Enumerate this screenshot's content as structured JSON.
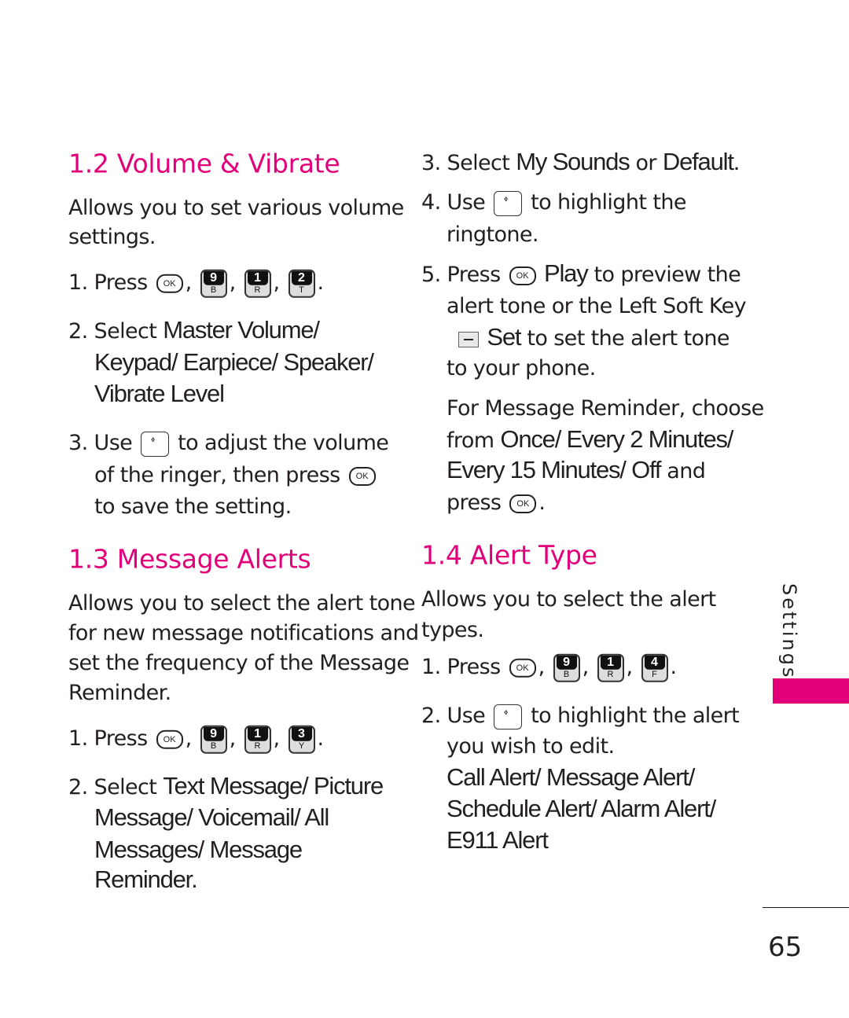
{
  "colors": {
    "accent": "#e2007a",
    "text": "#231f20"
  },
  "lines": [
    [
      {
        "h": "1.2 Volume & Vibrate"
      }
    ],
    [
      {
        "t": "Allows you to set various volume"
      }
    ],
    [
      {
        "t": "settings."
      }
    ],
    [
      {
        "t": "1. Press "
      },
      {
        "key": "ok",
        "d": "OK"
      },
      {
        "t": ", "
      },
      {
        "key": "num",
        "d": "9",
        "s": "B"
      },
      {
        "t": ", "
      },
      {
        "key": "num",
        "d": "1",
        "s": "R"
      },
      {
        "t": ", "
      },
      {
        "key": "num",
        "d": "2",
        "s": "T"
      },
      {
        "t": "."
      }
    ],
    [
      {
        "t": "2. Select "
      },
      {
        "b": "Master Volume/"
      }
    ],
    [
      {
        "b": "Keypad/ Earpiece/ Speaker/"
      }
    ],
    [
      {
        "b": "Vibrate Level"
      }
    ],
    [
      {
        "t": "3. Use "
      },
      {
        "key": "nav"
      },
      {
        "t": " to adjust the volume"
      }
    ],
    [
      {
        "t": "of the ringer, then press "
      },
      {
        "key": "ok",
        "d": "OK"
      }
    ],
    [
      {
        "t": "to save the setting."
      }
    ],
    [
      {
        "h": "1.3 Message Alerts"
      }
    ],
    [
      {
        "t": "Allows you to select the alert tone"
      }
    ],
    [
      {
        "t": "for new message notifications and"
      }
    ],
    [
      {
        "t": "set the frequency of the Message"
      }
    ],
    [
      {
        "t": "Reminder."
      }
    ],
    [
      {
        "t": "1. Press "
      },
      {
        "key": "ok",
        "d": "OK"
      },
      {
        "t": ", "
      },
      {
        "key": "num",
        "d": "9",
        "s": "B"
      },
      {
        "t": ", "
      },
      {
        "key": "num",
        "d": "1",
        "s": "R"
      },
      {
        "t": ", "
      },
      {
        "key": "num",
        "d": "3",
        "s": "Y"
      },
      {
        "t": "."
      }
    ],
    [
      {
        "t": "2. Select "
      },
      {
        "b": "Text Message/ Picture"
      }
    ],
    [
      {
        "b": "Message/ Voicemail/ All"
      }
    ],
    [
      {
        "b": "Messages/ Message"
      }
    ],
    [
      {
        "b": "Reminder."
      }
    ],
    [
      {
        "t": "3. Select "
      },
      {
        "b": "My Sounds"
      },
      {
        "t": " or "
      },
      {
        "b": "Default."
      }
    ],
    [
      {
        "t": "4. Use "
      },
      {
        "key": "nav"
      },
      {
        "t": " to highlight the"
      }
    ],
    [
      {
        "t": "ringtone."
      }
    ],
    [
      {
        "t": "5. Press "
      },
      {
        "key": "ok",
        "d": "OK"
      },
      {
        "b": " Play"
      },
      {
        "t": " to preview the"
      }
    ],
    [
      {
        "t": "alert tone or the Left Soft Key"
      }
    ],
    [
      {
        "key": "soft"
      },
      {
        "b": " Set"
      },
      {
        "t": " to set the alert tone"
      }
    ],
    [
      {
        "t": "to your phone."
      }
    ],
    [
      {
        "t": "For Message Reminder, choose"
      }
    ],
    [
      {
        "t": "from "
      },
      {
        "b": "Once/ Every 2 Minutes/"
      }
    ],
    [
      {
        "b": "Every 15 Minutes/ Off"
      },
      {
        "t": " and"
      }
    ],
    [
      {
        "t": "press "
      },
      {
        "key": "ok",
        "d": "OK"
      },
      {
        "t": "."
      }
    ],
    [
      {
        "h": "1.4 Alert Type"
      }
    ],
    [
      {
        "t": "Allows you to select the alert"
      }
    ],
    [
      {
        "t": "types."
      }
    ],
    [
      {
        "t": "1. Press "
      },
      {
        "key": "ok",
        "d": "OK"
      },
      {
        "t": ", "
      },
      {
        "key": "num",
        "d": "9",
        "s": "B"
      },
      {
        "t": ", "
      },
      {
        "key": "num",
        "d": "1",
        "s": "R"
      },
      {
        "t": ", "
      },
      {
        "key": "num",
        "d": "4",
        "s": "F"
      },
      {
        "t": "."
      }
    ],
    [
      {
        "t": "2. Use "
      },
      {
        "key": "nav"
      },
      {
        "t": " to highlight the alert"
      }
    ],
    [
      {
        "t": "you wish to edit."
      }
    ],
    [
      {
        "b": "Call Alert/ Message Alert/"
      }
    ],
    [
      {
        "b": "Schedule Alert/ Alarm Alert/"
      }
    ],
    [
      {
        "b": "E911 Alert"
      }
    ]
  ],
  "side_tab": "Settings",
  "page_number": "65"
}
